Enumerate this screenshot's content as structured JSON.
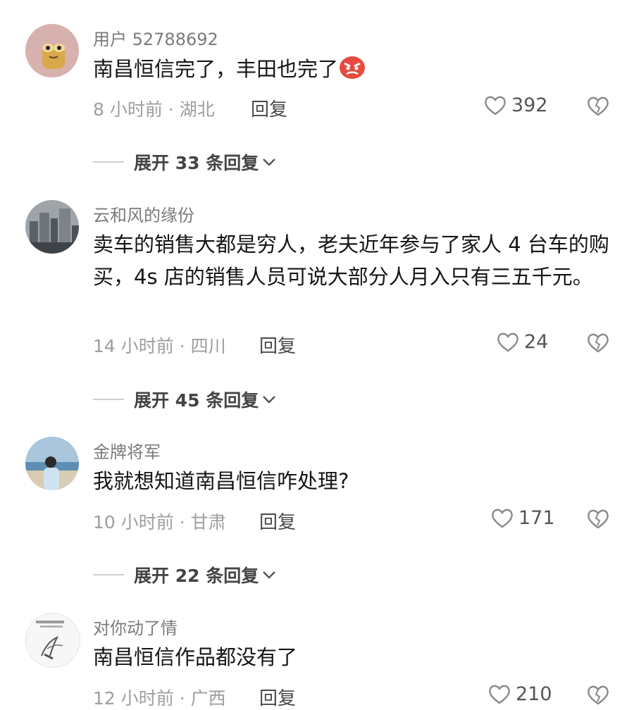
{
  "comments": [
    {
      "username": "用户 52788692",
      "content": "南昌恒信完了，丰田也完了",
      "content_emoji": "angry-face-emoji",
      "time": "8 小时前",
      "location": "湖北",
      "reply_label": "回复",
      "likes": "392",
      "expand_label": "展开 33 条回复",
      "avatar_icon": "cartoon-avatar"
    },
    {
      "username": "云和风的缘份",
      "content": "卖车的销售大都是穷人，老夫近年参与了家人 4 台车的购买，4s 店的销售人员可说大部分人月入只有三五千元。",
      "time": "14 小时前",
      "location": "四川",
      "reply_label": "回复",
      "likes": "24",
      "expand_label": "展开 45 条回复",
      "avatar_icon": "city-photo-avatar"
    },
    {
      "username": "金牌将军",
      "content": "我就想知道南昌恒信咋处理?",
      "time": "10 小时前",
      "location": "甘肃",
      "reply_label": "回复",
      "likes": "171",
      "expand_label": "展开 22 条回复",
      "avatar_icon": "beach-person-avatar"
    },
    {
      "username": "对你动了情",
      "content": "南昌恒信作品都没有了",
      "time": "12 小时前",
      "location": "广西",
      "reply_label": "回复",
      "likes": "210",
      "avatar_icon": "sketch-avatar"
    }
  ],
  "icons": {
    "like": "heart-outline-icon",
    "dislike": "broken-heart-icon",
    "expand": "chevron-down-icon"
  },
  "colors": {
    "username": "#7b7b7b",
    "meta": "#9e9e9e",
    "content": "#151515",
    "emoji_red": "#e84a3f"
  }
}
